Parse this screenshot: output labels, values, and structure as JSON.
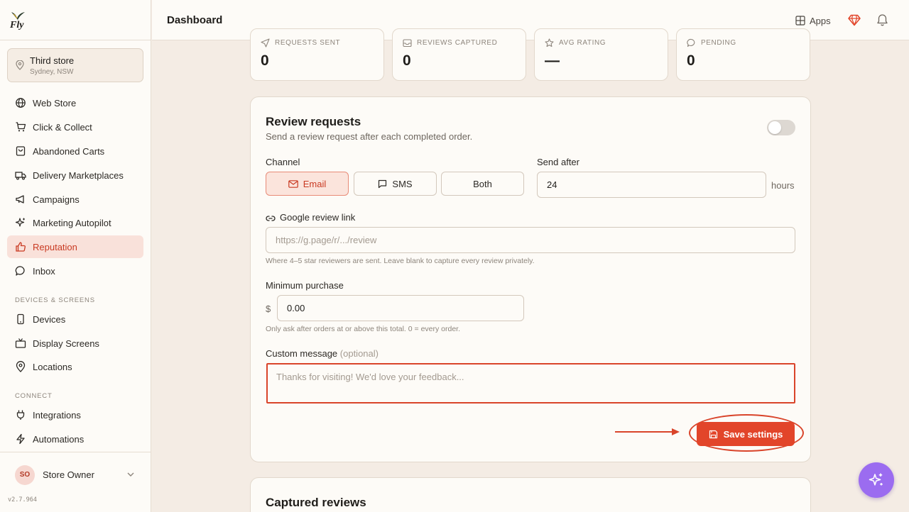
{
  "brand": {
    "logo_text": "Fly"
  },
  "store": {
    "name": "Third store",
    "location": "Sydney, NSW"
  },
  "nav": {
    "main": [
      {
        "label": "Web Store",
        "icon": "globe-icon"
      },
      {
        "label": "Click & Collect",
        "icon": "cart-icon"
      },
      {
        "label": "Abandoned Carts",
        "icon": "bag-icon"
      },
      {
        "label": "Delivery Marketplaces",
        "icon": "truck-icon"
      },
      {
        "label": "Campaigns",
        "icon": "megaphone-icon"
      },
      {
        "label": "Marketing Autopilot",
        "icon": "sparkle-icon"
      },
      {
        "label": "Reputation",
        "icon": "thumbs-up-icon",
        "active": true
      },
      {
        "label": "Inbox",
        "icon": "chat-icon"
      }
    ],
    "devices_heading": "DEVICES & SCREENS",
    "devices": [
      {
        "label": "Devices",
        "icon": "phone-icon"
      },
      {
        "label": "Display Screens",
        "icon": "tv-icon"
      },
      {
        "label": "Locations",
        "icon": "pin-icon"
      }
    ],
    "connect_heading": "CONNECT",
    "connect": [
      {
        "label": "Integrations",
        "icon": "plug-icon"
      },
      {
        "label": "Automations",
        "icon": "bolt-icon"
      }
    ]
  },
  "user": {
    "initials": "SO",
    "name": "Store Owner"
  },
  "version": "v2.7.964",
  "header": {
    "title": "Dashboard",
    "apps_label": "Apps"
  },
  "stats": [
    {
      "label": "REQUESTS SENT",
      "value": "0",
      "icon": "send-icon"
    },
    {
      "label": "REVIEWS CAPTURED",
      "value": "0",
      "icon": "inbox-icon"
    },
    {
      "label": "AVG RATING",
      "value": "—",
      "icon": "star-icon"
    },
    {
      "label": "PENDING",
      "value": "0",
      "icon": "chat-icon"
    }
  ],
  "review_requests": {
    "title": "Review requests",
    "subtitle": "Send a review request after each completed order.",
    "channel_label": "Channel",
    "channels": [
      "Email",
      "SMS",
      "Both"
    ],
    "selected_channel": "Email",
    "send_after_label": "Send after",
    "send_after_value": "24",
    "send_after_unit": "hours",
    "google_link_label": "Google review link",
    "google_link_placeholder": "https://g.page/r/.../review",
    "google_link_hint": "Where 4–5 star reviewers are sent. Leave blank to capture every review privately.",
    "min_purchase_label": "Minimum purchase",
    "currency": "$",
    "min_purchase_value": "0.00",
    "min_purchase_hint": "Only ask after orders at or above this total. 0 = every order.",
    "custom_message_label": "Custom message",
    "custom_message_optional": "(optional)",
    "custom_message_placeholder": "Thanks for visiting! We'd love your feedback...",
    "save_label": "Save settings",
    "enabled": false
  },
  "captured_reviews": {
    "title": "Captured reviews"
  },
  "colors": {
    "accent": "#e2452a",
    "fab": "#9b6cf0",
    "background": "#f4ece4"
  }
}
